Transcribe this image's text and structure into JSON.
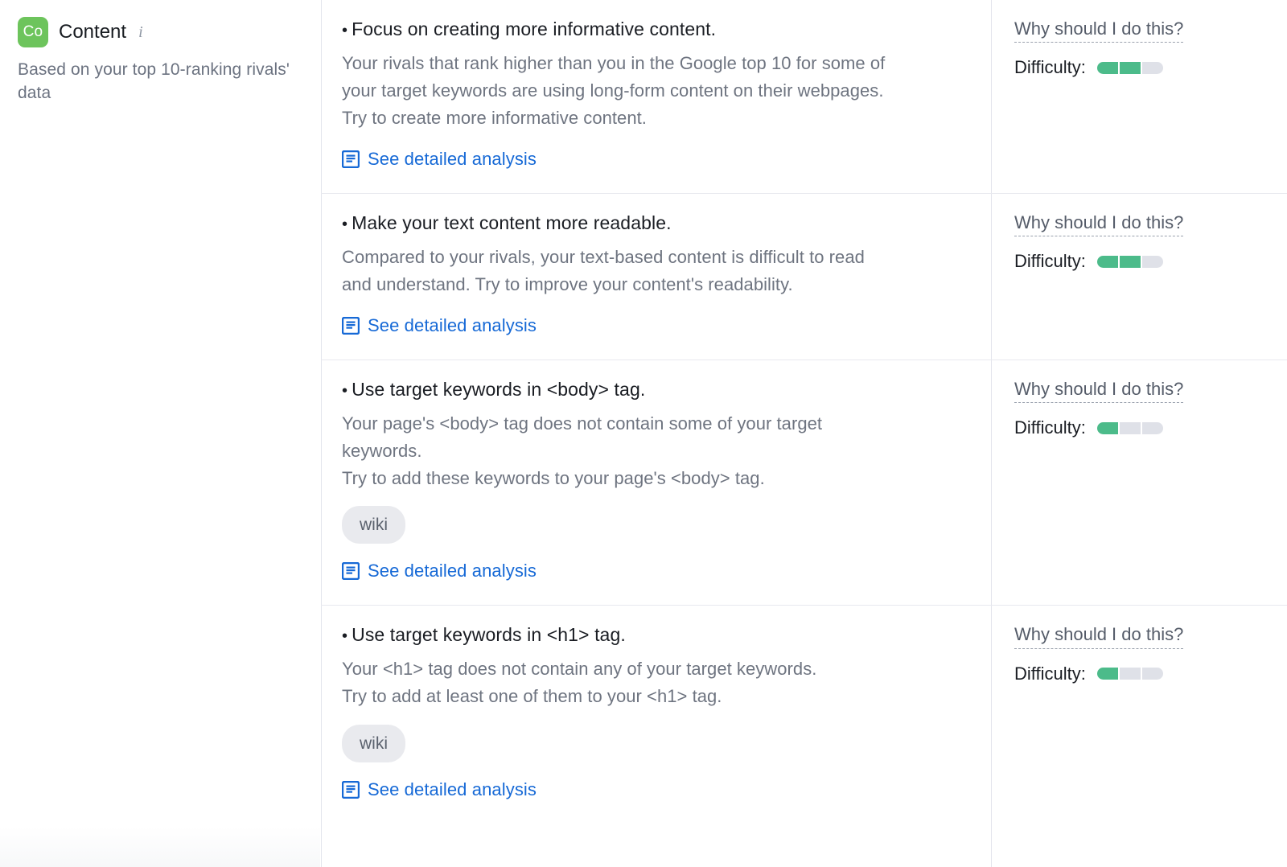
{
  "category": {
    "badge_text": "Co",
    "badge_color": "#6dc45c",
    "title": "Content",
    "info_icon": "info-icon",
    "subtitle": "Based on your top 10-ranking rivals' data"
  },
  "labels": {
    "why_link": "Why should I do this?",
    "difficulty_label": "Difficulty:",
    "analysis_link": "See detailed analysis",
    "analysis_icon": "document-lines-icon",
    "bullet": "•"
  },
  "colors": {
    "link": "#1669d6",
    "difficulty_on": "#4cbb8a",
    "difficulty_off": "#dfe1e8",
    "chip_bg": "#e9eaee",
    "divider": "#e8e9ef"
  },
  "difficulty_scale_max": 3,
  "rows": [
    {
      "title": "Focus on creating more informative content.",
      "body_lines": [
        "Your rivals that rank higher than you in the Google top 10 for some of",
        "your target keywords are using long-form content on their webpages.",
        "Try to create more informative content."
      ],
      "keywords": [],
      "analysis_link": "See detailed analysis",
      "why_link": "Why should I do this?",
      "difficulty_label": "Difficulty:",
      "difficulty": 2
    },
    {
      "title": "Make your text content more readable.",
      "body_lines": [
        "Compared to your rivals, your text-based content is difficult to read",
        "and understand. Try to improve your content's readability."
      ],
      "keywords": [],
      "analysis_link": "See detailed analysis",
      "why_link": "Why should I do this?",
      "difficulty_label": "Difficulty:",
      "difficulty": 2
    },
    {
      "title": "Use target keywords in <body> tag.",
      "body_lines": [
        "Your page's <body> tag does not contain some of your target",
        "keywords.",
        "Try to add these keywords to your page's <body> tag."
      ],
      "keywords": [
        "wiki"
      ],
      "analysis_link": "See detailed analysis",
      "why_link": "Why should I do this?",
      "difficulty_label": "Difficulty:",
      "difficulty": 1
    },
    {
      "title": "Use target keywords in <h1> tag.",
      "body_lines": [
        "Your <h1> tag does not contain any of your target keywords.",
        "Try to add at least one of them to your <h1> tag."
      ],
      "keywords": [
        "wiki"
      ],
      "analysis_link": "See detailed analysis",
      "why_link": "Why should I do this?",
      "difficulty_label": "Difficulty:",
      "difficulty": 1
    }
  ]
}
